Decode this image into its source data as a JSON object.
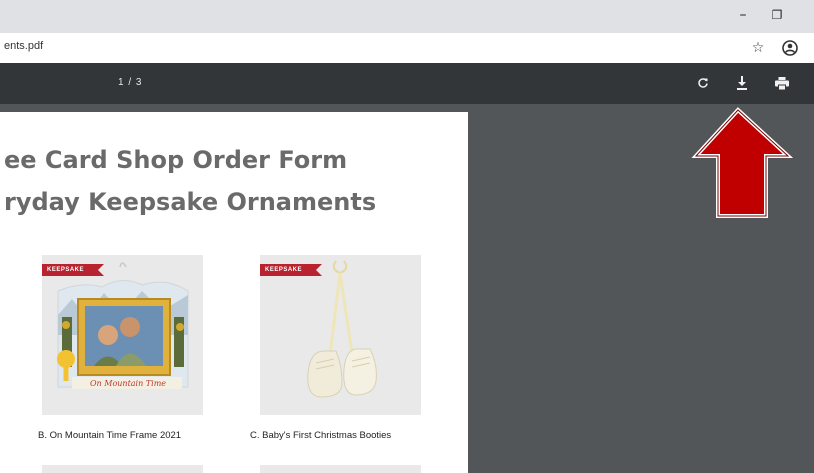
{
  "window": {
    "minimize_glyph": "–",
    "restore_glyph": "❐",
    "close_glyph": "×"
  },
  "addressbar": {
    "url": "ents.pdf",
    "star_icon": "star-icon",
    "account_icon": "account-icon"
  },
  "pdf_toolbar": {
    "page_indicator": "1 / 3",
    "rotate_icon": "rotate-icon",
    "download_icon": "download-icon",
    "print_icon": "print-icon"
  },
  "document": {
    "title_line1": "ee Card Shop Order Form",
    "title_line2": "ryday Keepsake Ornaments",
    "products": [
      {
        "badge": "KEEPSAKE",
        "caption": "B. On Mountain Time Frame 2021",
        "ornament_text": "On Mountain Time"
      },
      {
        "badge": "KEEPSAKE",
        "caption": "C.   Baby's First Christmas Booties"
      }
    ]
  },
  "annotation": {
    "arrow_color": "#c00000",
    "arrow_target": "download-icon"
  }
}
